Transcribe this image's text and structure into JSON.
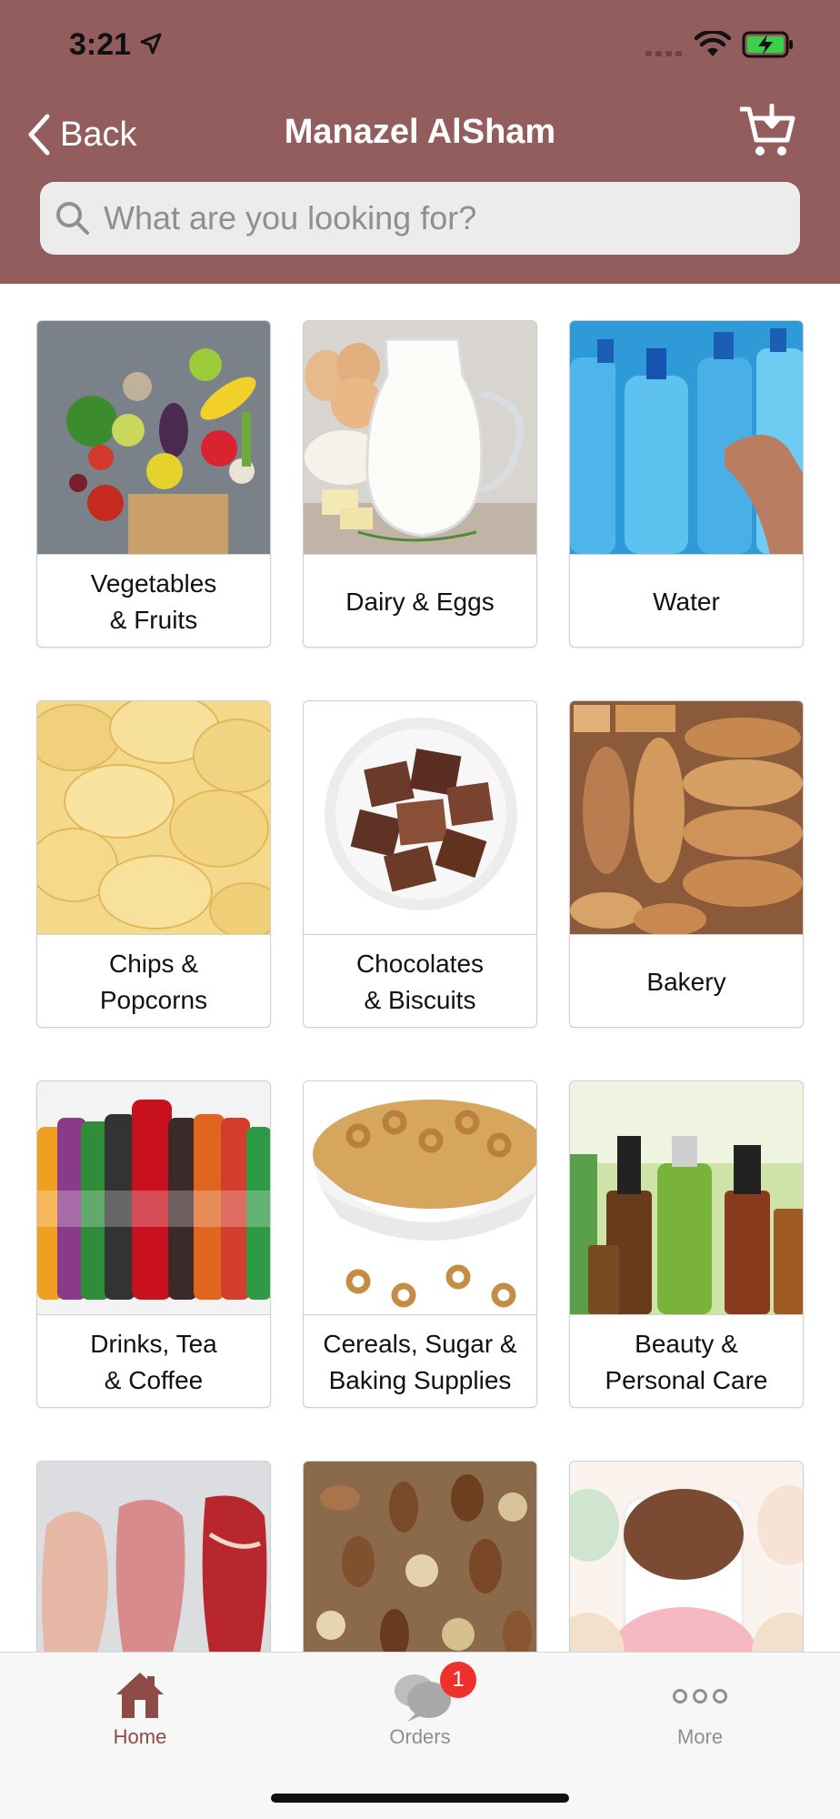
{
  "status_bar": {
    "time": "3:21"
  },
  "nav": {
    "back_label": "Back",
    "title": "Manazel AlSham"
  },
  "search": {
    "placeholder": "What are you looking for?"
  },
  "categories": [
    {
      "label": "Vegetables\n& Fruits",
      "icon": "vegetables-image"
    },
    {
      "label": "Dairy & Eggs",
      "icon": "dairy-image"
    },
    {
      "label": "Water",
      "icon": "water-image"
    },
    {
      "label": "Chips &\nPopcorns",
      "icon": "chips-image"
    },
    {
      "label": "Chocolates\n& Biscuits",
      "icon": "chocolate-image"
    },
    {
      "label": "Bakery",
      "icon": "bakery-image"
    },
    {
      "label": "Drinks, Tea\n& Coffee",
      "icon": "drinks-image"
    },
    {
      "label": "Cereals, Sugar &\nBaking Supplies",
      "icon": "cereal-image"
    },
    {
      "label": "Beauty &\nPersonal Care",
      "icon": "beauty-image"
    },
    {
      "label": "",
      "icon": "meat-image"
    },
    {
      "label": "",
      "icon": "nuts-image"
    },
    {
      "label": "",
      "icon": "ice-cream-image"
    }
  ],
  "tab_bar": {
    "home_label": "Home",
    "orders_label": "Orders",
    "orders_badge": "1",
    "more_label": "More"
  },
  "colors": {
    "header": "#935d5d",
    "accent": "#8e4a47",
    "badge": "#f0302c"
  }
}
